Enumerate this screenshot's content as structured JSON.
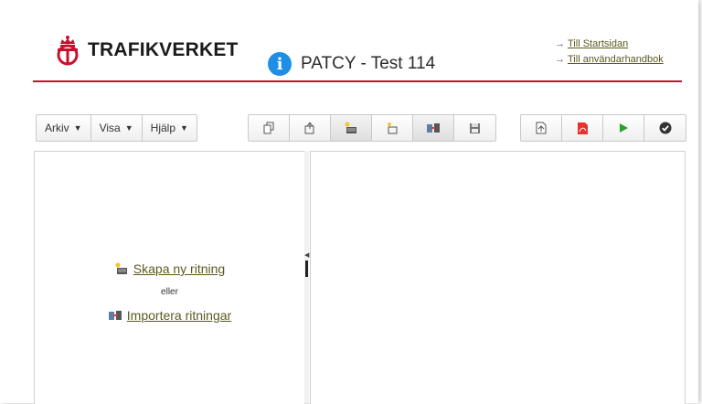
{
  "brand": {
    "name": "TRAFIKVERKET",
    "color": "#c8102e"
  },
  "app": {
    "title": "PATCY - Test 114",
    "icon": "info-icon"
  },
  "links": [
    {
      "label": "Till Startsidan"
    },
    {
      "label": "Till användarhandbok"
    }
  ],
  "menu": [
    {
      "label": "Arkiv"
    },
    {
      "label": "Visa"
    },
    {
      "label": "Hjälp"
    }
  ],
  "toolbar_icons": [
    "copy-icon",
    "upload-icon",
    "new-drawing-icon",
    "new-sheet-icon",
    "import-drawings-icon",
    "save-icon"
  ],
  "toolbar_icons_right": [
    "document-icon",
    "pdf-icon",
    "play-icon",
    "check-icon"
  ],
  "left_panel": {
    "create_label": "Skapa ny ritning",
    "or_label": "eller",
    "import_label": "Importera ritningar"
  },
  "colors": {
    "link": "#5a5a1e",
    "accent": "#1f8ee6",
    "play": "#2e9e2e"
  }
}
